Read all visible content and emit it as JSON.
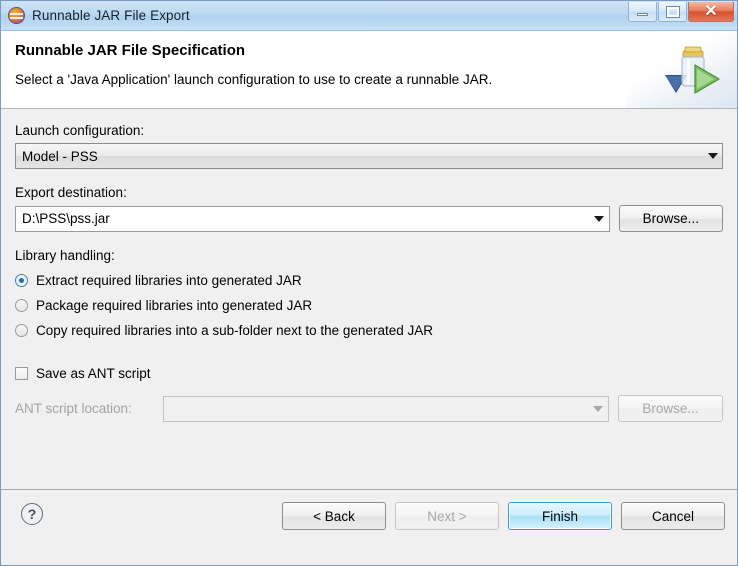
{
  "window": {
    "title": "Runnable JAR File Export",
    "app_icon": "eclipse-icon",
    "controls": {
      "minimize": "minimize-icon",
      "maximize": "maximize-icon",
      "close": "✕"
    }
  },
  "header": {
    "title": "Runnable JAR File Specification",
    "description": "Select a 'Java Application' launch configuration to use to create a runnable JAR.",
    "banner_icon": "jar-export-icon"
  },
  "launch_configuration": {
    "label": "Launch configuration:",
    "value": "Model - PSS",
    "dropdown_icon": "chevron-down-icon"
  },
  "export_destination": {
    "label": "Export destination:",
    "value": "D:\\PSS\\pss.jar",
    "dropdown_icon": "chevron-down-icon",
    "browse_label": "Browse..."
  },
  "library_handling": {
    "label": "Library handling:",
    "options": [
      {
        "label": "Extract required libraries into generated JAR",
        "selected": true
      },
      {
        "label": "Package required libraries into generated JAR",
        "selected": false
      },
      {
        "label": "Copy required libraries into a sub-folder next to the generated JAR",
        "selected": false
      }
    ]
  },
  "ant_script": {
    "checkbox_label": "Save as ANT script",
    "checked": false,
    "location_label": "ANT script location:",
    "location_value": "",
    "location_placeholder": "",
    "dropdown_icon": "chevron-down-icon",
    "browse_label": "Browse...",
    "enabled": false
  },
  "footer": {
    "help_label": "?",
    "buttons": {
      "back": "< Back",
      "next": "Next >",
      "finish": "Finish",
      "cancel": "Cancel"
    }
  },
  "colors": {
    "accent": "#2f9fd6",
    "titlebar": "#bcd9f2",
    "close_button": "#d4512c",
    "radio_selected": "#1f6fb5",
    "body_background": "#f0f0f0"
  }
}
